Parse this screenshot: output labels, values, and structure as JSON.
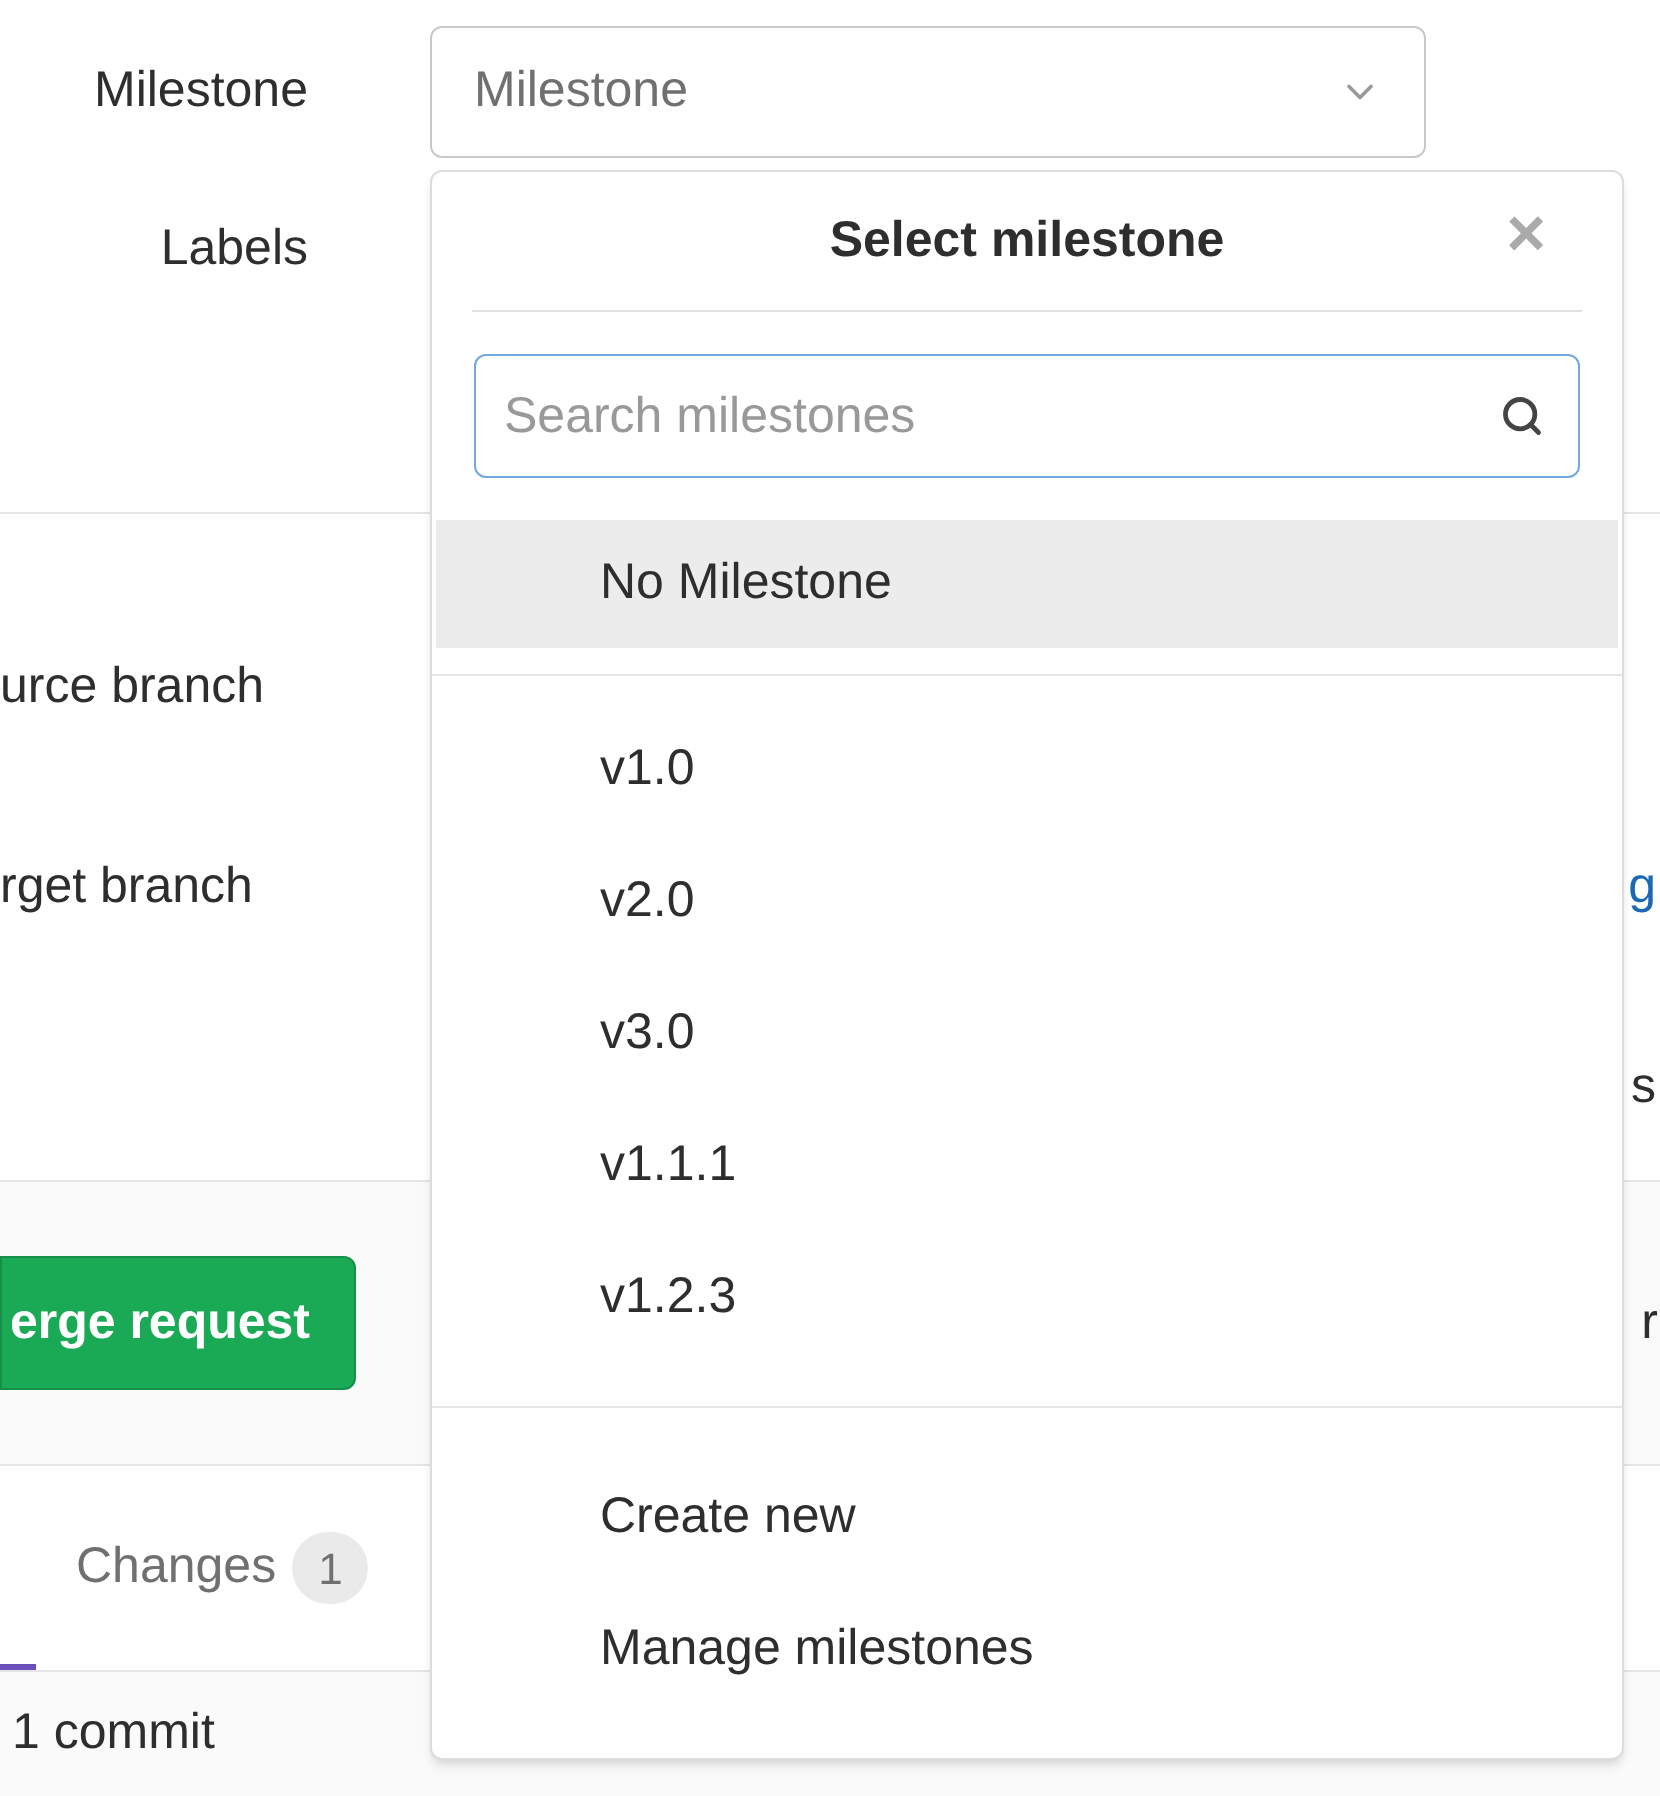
{
  "form": {
    "milestone_label": "Milestone",
    "milestone_select": "Milestone",
    "labels_label": "Labels"
  },
  "branches": {
    "source_label": "urce branch",
    "target_label": "rget branch",
    "target_link": "g",
    "cut_text": "s"
  },
  "actions": {
    "submit_button": "erge request",
    "right_text": "r"
  },
  "tabs": [
    {
      "label": "Changes",
      "count": "1",
      "selected": false
    }
  ],
  "tab_indicator": {
    "selected": true
  },
  "commits": "1 commit",
  "dropdown": {
    "title": "Select milestone",
    "close": "×",
    "search": {
      "placeholder": "Search milestones"
    },
    "top_items": [
      {
        "label": "No Milestone",
        "selected": true
      }
    ],
    "items": [
      {
        "label": "v1.0",
        "selected": false
      },
      {
        "label": "v2.0",
        "selected": false
      },
      {
        "label": "v3.0",
        "selected": false
      },
      {
        "label": "v1.1.1",
        "selected": false
      },
      {
        "label": "v1.2.3",
        "selected": false
      }
    ],
    "footer": [
      "Create new",
      "Manage milestones"
    ]
  }
}
